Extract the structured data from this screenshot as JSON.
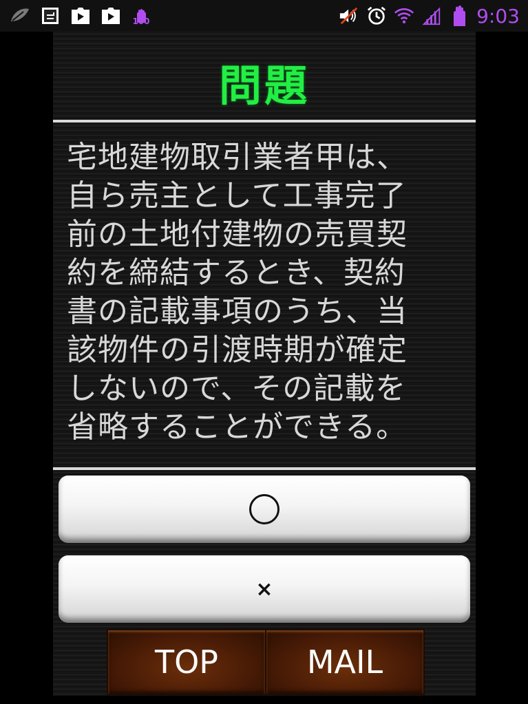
{
  "status_bar": {
    "time": "9:03",
    "badge": "100",
    "left_icons": [
      "leaf-icon",
      "screenshot-icon",
      "play-store-icon",
      "play-store-icon",
      "hand-100-icon"
    ],
    "right_icons": [
      "mute-icon",
      "alarm-icon",
      "wifi-icon",
      "signal-icon",
      "battery-hand-icon"
    ],
    "accent_color": "#b04df0"
  },
  "app": {
    "title": "問題",
    "question_lines": [
      "宅地建物取引業者甲は、",
      "自ら売主として工事完了",
      "前の土地付建物の売買契",
      "約を締結するとき、契約",
      "書の記載事項のうち、当",
      "該物件の引渡時期が確定",
      "しないので、その記載を",
      "省略することができる。"
    ],
    "answer_true_label": "○",
    "answer_false_label": "×",
    "top_button": "TOP",
    "mail_button": "MAIL",
    "title_color": "#22ee44"
  }
}
